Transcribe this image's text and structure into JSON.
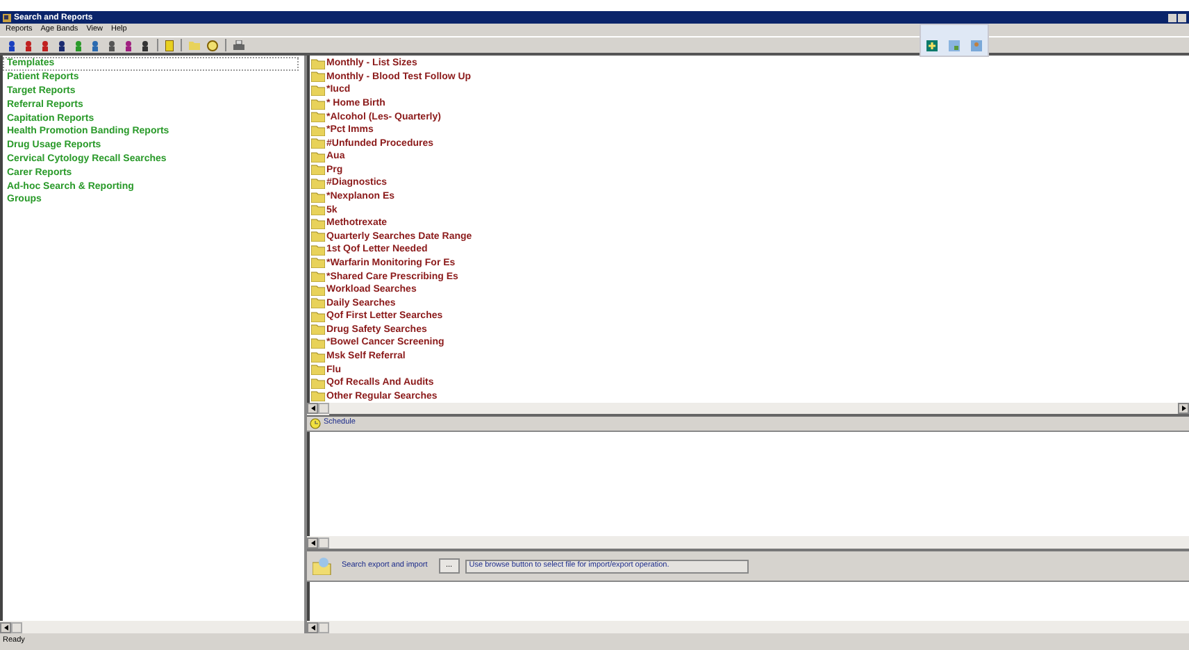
{
  "window": {
    "title": "Search and Reports"
  },
  "menu": [
    "Reports",
    "Age Bands",
    "View",
    "Help"
  ],
  "sidebar": {
    "items": [
      {
        "label": "Templates",
        "selected": true
      },
      {
        "label": "Patient Reports",
        "selected": false
      },
      {
        "label": "Target Reports",
        "selected": false
      },
      {
        "label": "Referral Reports",
        "selected": false
      },
      {
        "label": "Capitation Reports",
        "selected": false
      },
      {
        "label": "Health Promotion Banding Reports",
        "selected": false
      },
      {
        "label": "Drug Usage Reports",
        "selected": false
      },
      {
        "label": "Cervical Cytology Recall Searches",
        "selected": false
      },
      {
        "label": "Carer Reports",
        "selected": false
      },
      {
        "label": "Ad-hoc Search & Reporting",
        "selected": false
      },
      {
        "label": "Groups",
        "selected": false
      }
    ]
  },
  "folders": [
    "Monthly - List Sizes",
    "Monthly - Blood Test Follow Up",
    "*Iucd",
    "* Home Birth",
    "*Alcohol (Les- Quarterly)",
    "*Pct Imms",
    "#Unfunded Procedures",
    "Aua",
    "Prg",
    "#Diagnostics",
    "*Nexplanon Es",
    "5k",
    "Methotrexate",
    "Quarterly Searches Date Range",
    "1st Qof Letter Needed",
    "*Warfarin Monitoring For Es",
    "*Shared Care Prescribing Es",
    "Workload Searches",
    "Daily Searches",
    "Qof First Letter Searches",
    "Drug Safety Searches",
    "*Bowel Cancer Screening",
    "Msk Self Referral",
    "Flu",
    "Qof Recalls And Audits",
    "Other Regular Searches"
  ],
  "schedule": {
    "title": "Schedule"
  },
  "export": {
    "label": "Search export and import",
    "browse_button": "...",
    "message": "Use browse button to select file for import/export operation."
  },
  "status_bar": "Ready"
}
